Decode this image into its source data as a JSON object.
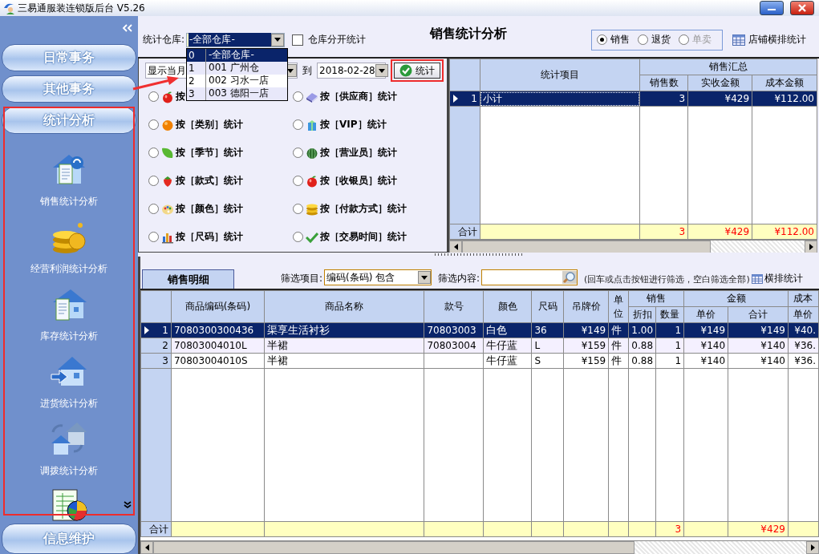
{
  "window": {
    "title": "三易通服装连锁版后台 V5.26"
  },
  "sidebar": {
    "sections": [
      {
        "label": "日常事务"
      },
      {
        "label": "其他事务"
      },
      {
        "label": "统计分析"
      }
    ],
    "items": [
      {
        "kind": "sales",
        "label": "销售统计分析"
      },
      {
        "kind": "profit",
        "label": "经营利润统计分析"
      },
      {
        "kind": "stock",
        "label": "库存统计分析"
      },
      {
        "kind": "purchase",
        "label": "进货统计分析"
      },
      {
        "kind": "transfer",
        "label": "调拨统计分析"
      },
      {
        "kind": "report"
      }
    ],
    "footer_section": {
      "label": "信息维护"
    }
  },
  "warehouse": {
    "label": "统计仓库:",
    "value": "-全部仓库-",
    "options": [
      {
        "index": "0",
        "label": "-全部仓库-",
        "selected": true
      },
      {
        "index": "1",
        "label": "001  广州仓",
        "selected": false
      },
      {
        "index": "2",
        "label": "002  习水一店",
        "selected": false
      },
      {
        "index": "3",
        "label": "003  德阳一店",
        "selected": false
      }
    ]
  },
  "split_by_warehouse": {
    "label": "仓库分开统计",
    "checked": false
  },
  "title": "销售统计分析",
  "mode": [
    {
      "label": "销售",
      "selected": true,
      "disabled": false
    },
    {
      "label": "退货",
      "selected": false,
      "disabled": false
    },
    {
      "label": "单卖",
      "selected": false,
      "disabled": true
    }
  ],
  "store_layout_button": "店铺横排统计",
  "period": {
    "value": "显示当月",
    "to_label": "到",
    "end_date": "2018-02-28"
  },
  "run_button": "统计",
  "group_by": [
    {
      "kind": "apple",
      "label": "按",
      "selected": false
    },
    {
      "kind": "book",
      "label": "按［供应商］统计",
      "selected": false
    },
    {
      "kind": "orange",
      "label": "按［类别］统计",
      "selected": false
    },
    {
      "kind": "gift",
      "label": "按［VIP］统计",
      "selected": false
    },
    {
      "kind": "leaf",
      "label": "按［季节］统计",
      "selected": false
    },
    {
      "kind": "melon",
      "label": "按［营业员］统计",
      "selected": false
    },
    {
      "kind": "strawberry",
      "label": "按［款式］统计",
      "selected": false
    },
    {
      "kind": "apple",
      "label": "按［收银员］统计",
      "selected": false
    },
    {
      "kind": "palette",
      "label": "按［颜色］统计",
      "selected": false
    },
    {
      "kind": "coins",
      "label": "按［付款方式］统计",
      "selected": false
    },
    {
      "kind": "chart",
      "label": "按［尺码］统计",
      "selected": false
    },
    {
      "kind": "check",
      "label": "按［交易时间］统计",
      "selected": false
    }
  ],
  "summary": {
    "columns": [
      {
        "label": "统计项目"
      },
      {
        "label": "销售汇总",
        "colspan": 3,
        "children": [
          "销售数",
          "实收金额",
          "成本金额"
        ]
      }
    ],
    "rows": [
      {
        "index": "1",
        "selected": true,
        "cells": [
          "小计",
          "3",
          "¥429",
          "¥112.00"
        ]
      }
    ],
    "total": {
      "label": "合计",
      "cells": [
        null,
        "3",
        "¥429",
        "¥112.00"
      ]
    }
  },
  "detail": {
    "tab": "销售明细",
    "filter_label": "筛选项目:",
    "filter_value": "编码(条码) 包含",
    "content_label": "筛选内容:",
    "hint": "(回车或点击按钮进行筛选，空白筛选全部)",
    "layout_button": "横排统计",
    "columns": [
      {
        "label": "商品编码(条码)"
      },
      {
        "label": "商品名称"
      },
      {
        "label": "款号"
      },
      {
        "label": "颜色"
      },
      {
        "label": "尺码"
      },
      {
        "label": "吊牌价"
      },
      {
        "label": "单位"
      },
      {
        "label": "销售",
        "colspan": 2,
        "children": [
          "折扣",
          "数量"
        ]
      },
      {
        "label": "金额",
        "colspan": 2,
        "children": [
          "单价",
          "合计"
        ]
      },
      {
        "label": "成本",
        "children": [
          "单价"
        ]
      }
    ],
    "rows": [
      {
        "index": "1",
        "selected": true,
        "cells": [
          "7080300300436",
          "渠享生活衬衫",
          "70803003",
          "白色",
          "36",
          "¥149",
          "件",
          "1.00",
          "1",
          "¥149",
          "¥149",
          "¥40."
        ]
      },
      {
        "index": "2",
        "selected": false,
        "cells": [
          "70803004010L",
          "半裙",
          "70803004",
          "牛仔蓝",
          "L",
          "¥159",
          "件",
          "0.88",
          "1",
          "¥140",
          "¥140",
          "¥36."
        ]
      },
      {
        "index": "3",
        "selected": false,
        "cells": [
          "70803004010S",
          "半裙",
          null,
          "牛仔蓝",
          "S",
          "¥159",
          "件",
          "0.88",
          "1",
          "¥140",
          "¥140",
          "¥36."
        ]
      }
    ],
    "total": {
      "label": "合计",
      "cells": [
        null,
        null,
        null,
        null,
        null,
        null,
        null,
        null,
        "3",
        null,
        "¥429",
        null
      ]
    }
  }
}
